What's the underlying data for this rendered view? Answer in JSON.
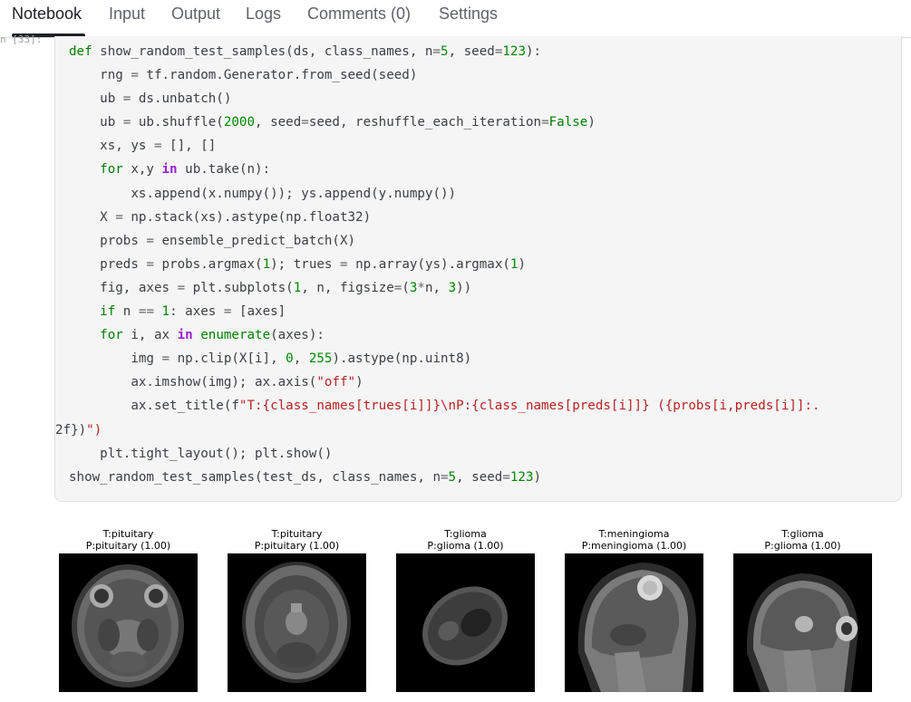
{
  "tabs": [
    {
      "label": "Notebook"
    },
    {
      "label": "Input"
    },
    {
      "label": "Output"
    },
    {
      "label": "Logs"
    },
    {
      "label": "Comments (0)"
    },
    {
      "label": "Settings"
    }
  ],
  "cell": {
    "prompt": "n [33]:",
    "code_lines": [
      "def show_random_test_samples(ds, class_names, n=5, seed=123):",
      "    rng = tf.random.Generator.from_seed(seed)",
      "    ub = ds.unbatch()",
      "    ub = ub.shuffle(2000, seed=seed, reshuffle_each_iteration=False)",
      "    xs, ys = [], []",
      "    for x,y in ub.take(n):",
      "        xs.append(x.numpy()); ys.append(y.numpy())",
      "    X = np.stack(xs).astype(np.float32)",
      "    probs = ensemble_predict_batch(X)",
      "    preds = probs.argmax(1); trues = np.array(ys).argmax(1)",
      "    fig, axes = plt.subplots(1, n, figsize=(3*n, 3))",
      "    if n == 1: axes = [axes]",
      "    for i, ax in enumerate(axes):",
      "        img = np.clip(X[i], 0, 255).astype(np.uint8)",
      "        ax.imshow(img); ax.axis(\"off\")",
      "        ax.set_title(f\"T:{class_names[trues[i]]}\\nP:{class_names[preds[i]]} ({probs[i,preds[i]]:.",
      "2f})\")",
      "    plt.tight_layout(); plt.show()",
      "show_random_test_samples(test_ds, class_names, n=5, seed=123)"
    ]
  },
  "output": {
    "samples": [
      {
        "true_label": "T:pituitary",
        "pred_label": "P:pituitary (1.00)",
        "image": "axial-mri-scan"
      },
      {
        "true_label": "T:pituitary",
        "pred_label": "P:pituitary (1.00)",
        "image": "axial-mri-scan"
      },
      {
        "true_label": "T:glioma",
        "pred_label": "P:glioma (1.00)",
        "image": "rotated-mri-scan"
      },
      {
        "true_label": "T:meningioma",
        "pred_label": "P:meningioma (1.00)",
        "image": "sagittal-mri-scan"
      },
      {
        "true_label": "T:glioma",
        "pred_label": "P:glioma (1.00)",
        "image": "sagittal-mri-scan"
      }
    ]
  }
}
